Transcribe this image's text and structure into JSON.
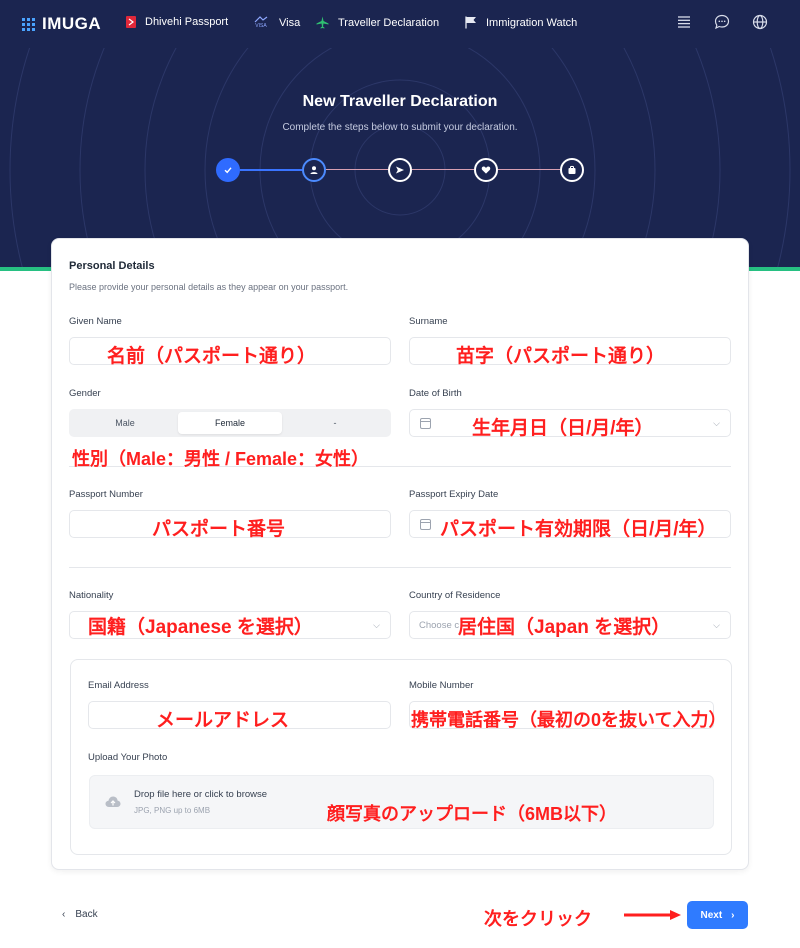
{
  "nav": {
    "logo": "IMUGA",
    "items": [
      {
        "label": "Dhivehi Passport",
        "icon": "passport-icon"
      },
      {
        "label": "Visa",
        "icon": "visa-icon"
      },
      {
        "label": "Traveller Declaration",
        "icon": "airplane-icon"
      },
      {
        "label": "Immigration Watch",
        "icon": "flag-icon"
      }
    ],
    "right_icons": [
      "menu-icon",
      "chat-icon",
      "globe-icon"
    ],
    "visa_badge": "VISA"
  },
  "hero": {
    "title": "New Traveller Declaration",
    "subtitle": "Complete the steps below to submit your declaration.",
    "steps": [
      {
        "icon": "check-icon",
        "state": "done"
      },
      {
        "icon": "person-icon",
        "state": "current"
      },
      {
        "icon": "send-icon",
        "state": "upcoming"
      },
      {
        "icon": "heart-icon",
        "state": "upcoming"
      },
      {
        "icon": "bag-icon",
        "state": "upcoming"
      }
    ]
  },
  "form": {
    "section_title": "Personal Details",
    "section_subtitle": "Please provide your personal details as they appear on your passport.",
    "given_name_label": "Given Name",
    "surname_label": "Surname",
    "gender_label": "Gender",
    "gender_options": [
      "Male",
      "Female",
      "-"
    ],
    "gender_selected": "Female",
    "dob_label": "Date of Birth",
    "passport_number_label": "Passport Number",
    "passport_expiry_label": "Passport Expiry Date",
    "nationality_label": "Nationality",
    "residence_label": "Country of Residence",
    "residence_placeholder": "Choose c",
    "email_label": "Email Address",
    "mobile_label": "Mobile Number",
    "photo_label": "Upload Your Photo",
    "upload_text": "Drop file here or click to browse",
    "upload_hint": "JPG, PNG up to 6MB"
  },
  "annotations": {
    "given_name": "名前（パスポート通り）",
    "surname": "苗字（パスポート通り）",
    "dob": "生年月日（日/月/年）",
    "gender": "性別（Male：男性 / Female：女性）",
    "passport_number": "パスポート番号",
    "passport_expiry": "パスポート有効期限（日/月/年）",
    "nationality": "国籍（Japanese を選択）",
    "residence": "居住国（Japan を選択）",
    "email": "メールアドレス",
    "mobile": "携帯電話番号（最初の0を抜いて入力）",
    "photo": "顔写真のアップロード（6MB以下）",
    "click_next": "次をクリック"
  },
  "footer": {
    "back_label": "Back",
    "next_label": "Next"
  },
  "colors": {
    "navy": "#1b2550",
    "accent_blue": "#2f7bff",
    "green_stripe": "#27c082",
    "annotation_red": "#ff1f1f"
  }
}
